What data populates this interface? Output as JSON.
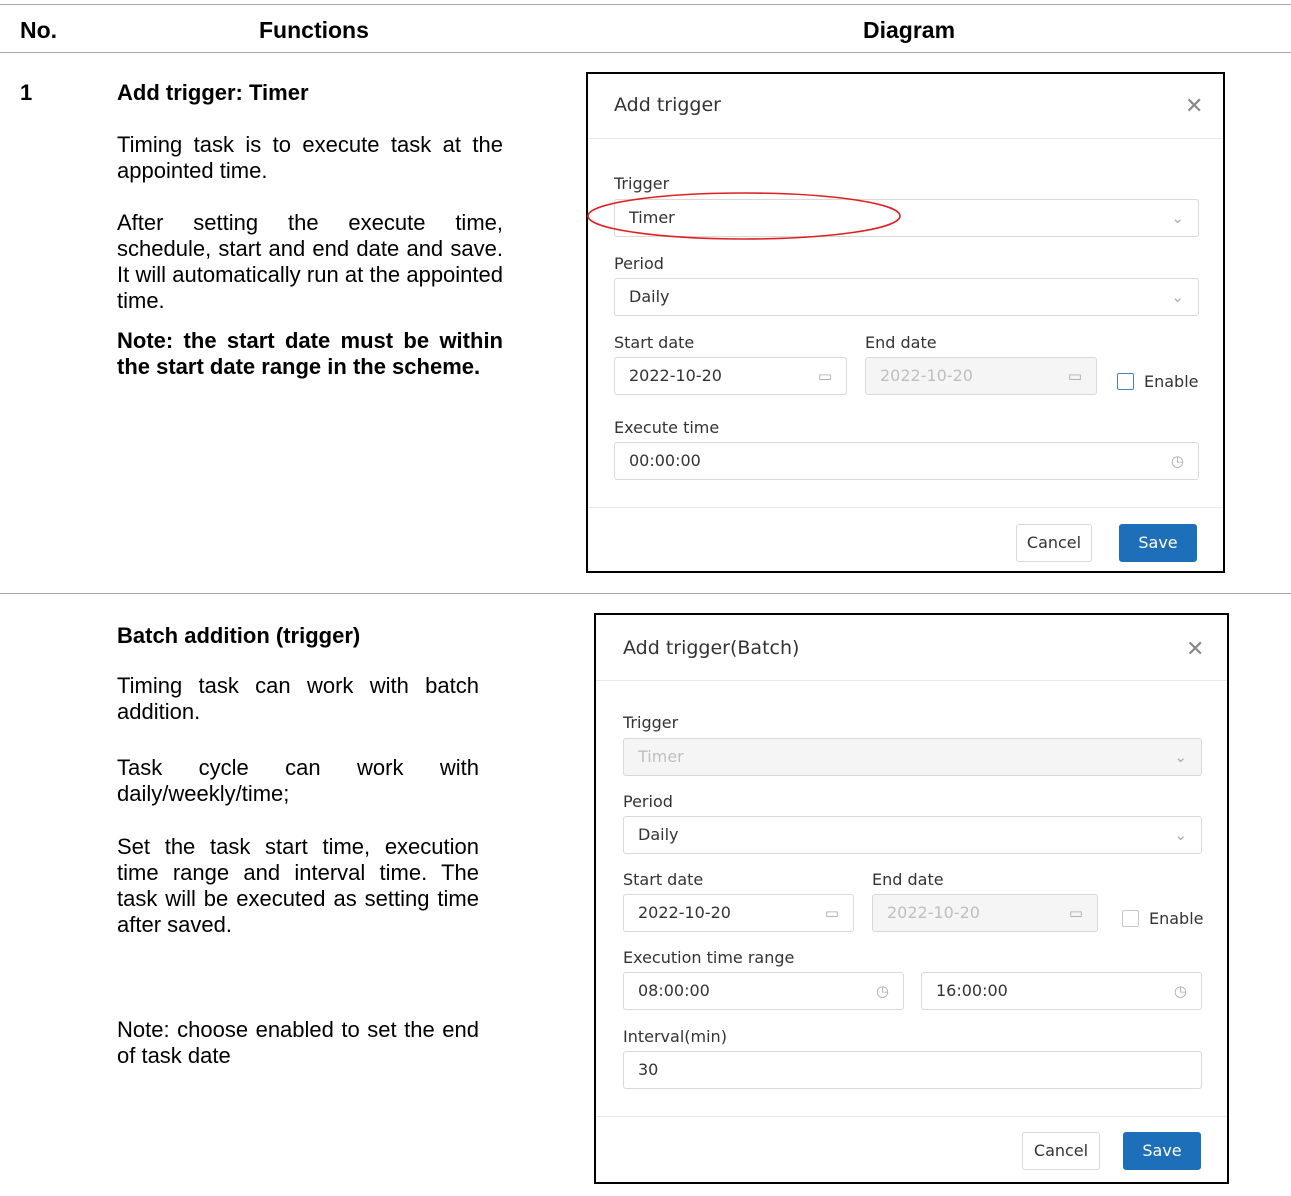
{
  "table": {
    "headers": {
      "no": "No.",
      "functions": "Functions",
      "diagram": "Diagram"
    }
  },
  "rows": [
    {
      "number": "1",
      "title": "Add trigger: Timer",
      "paragraphs": [
        "Timing task is to execute task at the appointed time.",
        "After setting the execute time, schedule, start and end date and save. It will automatically run at the appointed time."
      ],
      "note": "Note: the start date must be within the start date range in the scheme.",
      "dialog": {
        "title": "Add trigger",
        "close_icon": "close-icon",
        "trigger_label": "Trigger",
        "trigger_value": "Timer",
        "period_label": "Period",
        "period_value": "Daily",
        "start_date_label": "Start date",
        "start_date_value": "2022-10-20",
        "end_date_label": "End date",
        "end_date_value": "2022-10-20",
        "enable_label": "Enable",
        "execute_time_label": "Execute time",
        "execute_time_value": "00:00:00",
        "cancel_label": "Cancel",
        "save_label": "Save",
        "highlight_color": "#e02020",
        "accent_color": "#1e6fb9"
      }
    },
    {
      "number": "",
      "title": "Batch addition (trigger)",
      "paragraphs": [
        "Timing task can work with batch addition.",
        "Task cycle can work with daily/weekly/time;",
        "Set the task start time, execution time range and interval time. The task will be executed as setting time after saved.",
        "Note: choose enabled to set the end of task date"
      ],
      "dialog": {
        "title": "Add trigger(Batch)",
        "close_icon": "close-icon",
        "trigger_label": "Trigger",
        "trigger_value": "Timer",
        "period_label": "Period",
        "period_value": "Daily",
        "start_date_label": "Start date",
        "start_date_value": "2022-10-20",
        "end_date_label": "End date",
        "end_date_value": "2022-10-20",
        "enable_label": "Enable",
        "execution_range_label": "Execution time range",
        "range_start_value": "08:00:00",
        "range_end_value": "16:00:00",
        "interval_label": "Interval(min)",
        "interval_value": "30",
        "cancel_label": "Cancel",
        "save_label": "Save",
        "highlight_color": "#e02020",
        "accent_color": "#1e6fb9"
      }
    }
  ]
}
